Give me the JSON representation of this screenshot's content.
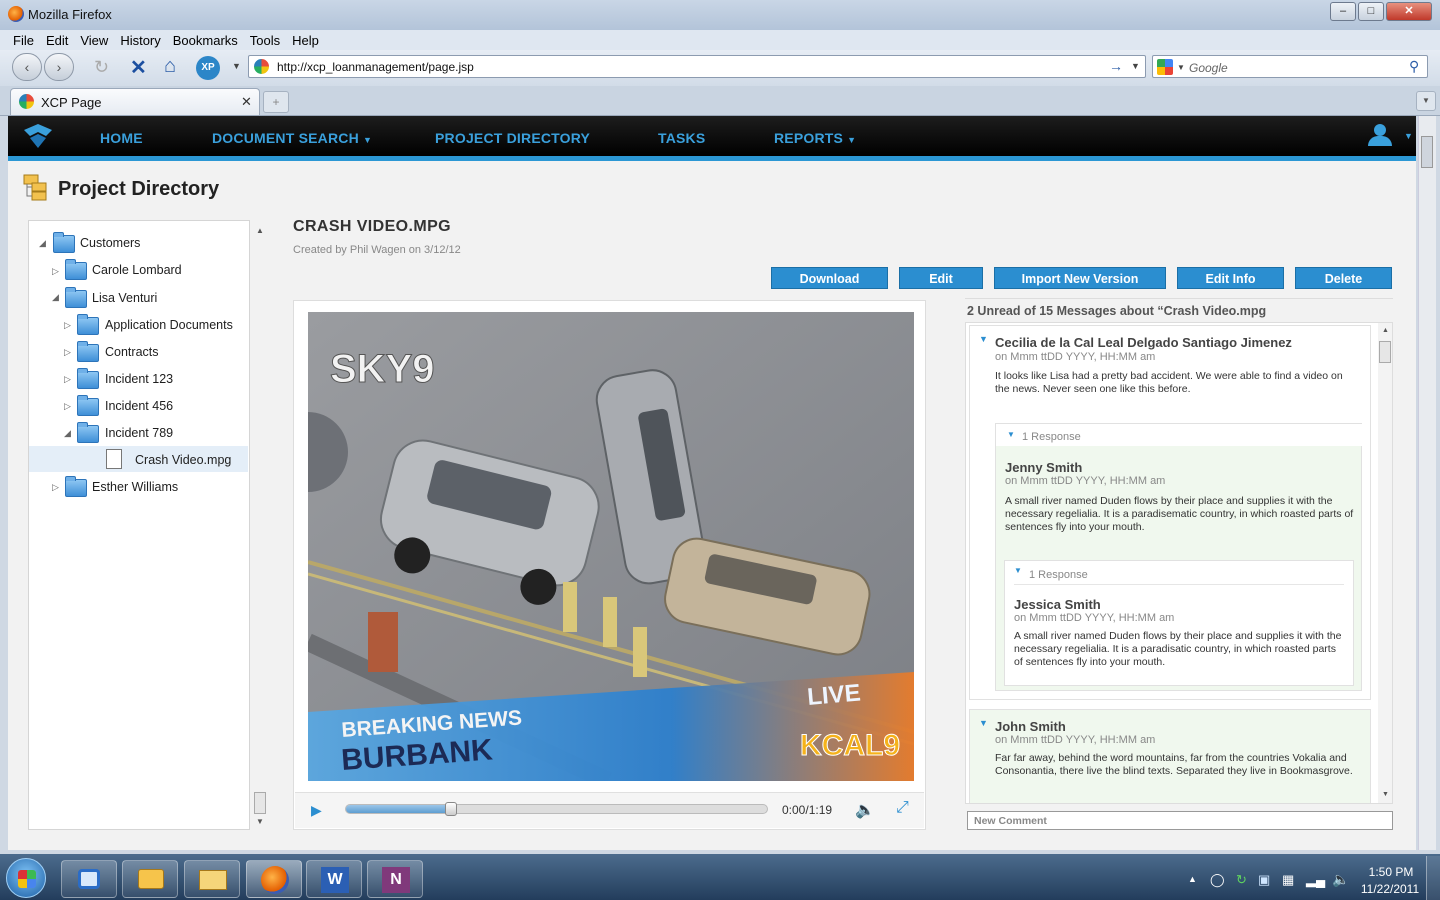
{
  "window": {
    "title": "Mozilla Firefox"
  },
  "menu": [
    "File",
    "Edit",
    "View",
    "History",
    "Bookmarks",
    "Tools",
    "Help"
  ],
  "browser": {
    "url": "http://xcp_loanmanagement/page.jsp",
    "search_placeholder": "Google",
    "tab_title": "XCP Page"
  },
  "appnav": {
    "items": [
      "HOME",
      "DOCUMENT SEARCH",
      "PROJECT DIRECTORY",
      "TASKS",
      "REPORTS"
    ]
  },
  "page": {
    "title": "Project Directory"
  },
  "tree": {
    "customers": "Customers",
    "carole": "Carole Lombard",
    "lisa": "Lisa Venturi",
    "app_docs": "Application Documents",
    "contracts": "Contracts",
    "inc123": "Incident 123",
    "inc456": "Incident 456",
    "inc789": "Incident 789",
    "crash": "Crash Video.mpg",
    "esther": "Esther Williams"
  },
  "file": {
    "title": "CRASH VIDEO.MPG",
    "created_by": "Created by Phil Wagen on 3/12/12"
  },
  "actions": {
    "download": "Download",
    "edit": "Edit",
    "import": "Import New Version",
    "editinfo": "Edit Info",
    "delete": "Delete"
  },
  "video": {
    "time": "0:00/1:19",
    "progress": 0.25,
    "overlay_logo": "SKY9",
    "live": "LIVE",
    "breaking": "BREAKING NEWS",
    "place": "BURBANK",
    "station": "KCAL9"
  },
  "messages": {
    "header": "2 Unread of 15 Messages  about “Crash Video.mpg",
    "m1": {
      "name": "Cecilia de la Cal Leal Delgado Santiago Jimenez",
      "date": "on Mmm ttDD YYYY, HH:MM am",
      "body": "It looks like Lisa had a pretty bad accident. We were able to find a video on the news. Never seen one like this before."
    },
    "r1_label": "1 Response",
    "m2": {
      "name": "Jenny Smith",
      "date": "on Mmm ttDD YYYY, HH:MM am",
      "body": "A small river named Duden flows by their place and supplies it with the necessary regelialia. It is a paradisematic country, in which roasted parts of sentences fly into your mouth."
    },
    "r2_label": "1 Response",
    "m3": {
      "name": "Jessica Smith",
      "date": "on Mmm ttDD YYYY, HH:MM am",
      "body": "A small river named Duden flows by their place and supplies it with the necessary regelialia. It is a paradisatic country, in which roasted parts of sentences fly into your mouth."
    },
    "m4": {
      "name": "John Smith",
      "date": "on Mmm ttDD YYYY, HH:MM am",
      "body": "Far far away, behind the word mountains, far from the countries Vokalia and Consonantia, there live the blind texts. Separated they live in Bookmasgrove."
    },
    "new_comment": "New Comment"
  },
  "taskbar": {
    "time": "1:50 PM",
    "date": "11/22/2011"
  },
  "colors": {
    "accent": "#2b8ed0",
    "nav_link": "#3aa0dc",
    "nav_bg": "#000000"
  }
}
